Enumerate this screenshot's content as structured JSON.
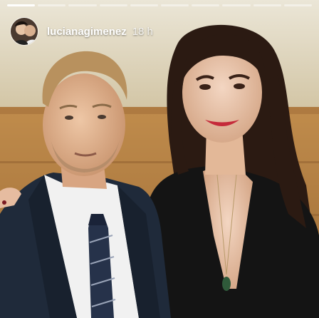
{
  "story": {
    "username": "lucianagimenez",
    "time_ago": "18 h",
    "avatar_icon": "profile-photo",
    "progress_segments": 10,
    "progress_done": 1
  },
  "colors": {
    "text": "#ffffff",
    "wall": "#cdb48a",
    "wood": "#b27a3e",
    "suit": "#1f2a3a",
    "dress": "#141414"
  }
}
